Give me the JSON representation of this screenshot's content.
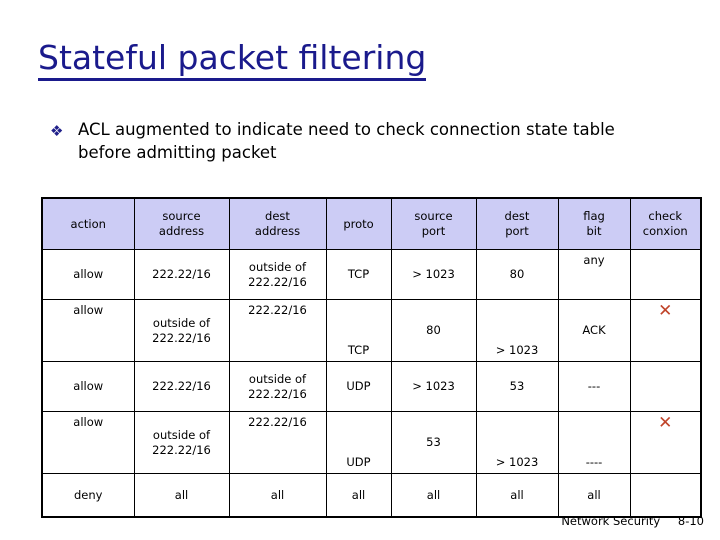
{
  "slide": {
    "title": "Stateful packet filtering",
    "title_color": "#1a1a8c",
    "bullet_marker": "❖",
    "bullet_text": "ACL augmented to indicate need to check connection state table before admitting packet"
  },
  "table": {
    "header_bg": "#ccccf5",
    "xmark_color": "#c0442a",
    "xmark_glyph": "✕",
    "columns": [
      {
        "line1": "action",
        "line2": ""
      },
      {
        "line1": "source",
        "line2": "address"
      },
      {
        "line1": "dest",
        "line2": "address"
      },
      {
        "line1": "proto",
        "line2": ""
      },
      {
        "line1": "source",
        "line2": "port"
      },
      {
        "line1": "dest",
        "line2": "port"
      },
      {
        "line1": "flag",
        "line2": "bit"
      },
      {
        "line1": "check",
        "line2": "conxion"
      }
    ],
    "rows": [
      {
        "action": "allow",
        "source_address_l1": "222.22/16",
        "source_address_l2": "",
        "dest_address_l1": "outside of",
        "dest_address_l2": "222.22/16",
        "proto": "TCP",
        "source_port": "> 1023",
        "dest_port": "80",
        "flag_bit": "any",
        "check_conxion": ""
      },
      {
        "action": "allow",
        "source_address_l1": "outside of",
        "source_address_l2": "222.22/16",
        "dest_address_l1": "222.22/16",
        "dest_address_l2": "",
        "proto": "TCP",
        "source_port": "80",
        "dest_port": "> 1023",
        "flag_bit": "ACK",
        "check_conxion": "✕"
      },
      {
        "action": "allow",
        "source_address_l1": "222.22/16",
        "source_address_l2": "",
        "dest_address_l1": "outside of",
        "dest_address_l2": "222.22/16",
        "proto": "UDP",
        "source_port": "> 1023",
        "dest_port": "53",
        "flag_bit": "---",
        "check_conxion": ""
      },
      {
        "action": "allow",
        "source_address_l1": "outside of",
        "source_address_l2": "222.22/16",
        "dest_address_l1": "222.22/16",
        "dest_address_l2": "",
        "proto": "UDP",
        "source_port": "53",
        "dest_port": "> 1023",
        "flag_bit": "----",
        "check_conxion": "✕"
      },
      {
        "action": "deny",
        "source_address_l1": "all",
        "source_address_l2": "",
        "dest_address_l1": "all",
        "dest_address_l2": "",
        "proto": "all",
        "source_port": "all",
        "dest_port": "all",
        "flag_bit": "all",
        "check_conxion": ""
      }
    ]
  },
  "footer": {
    "course": "Network Security",
    "page": "8-10"
  }
}
